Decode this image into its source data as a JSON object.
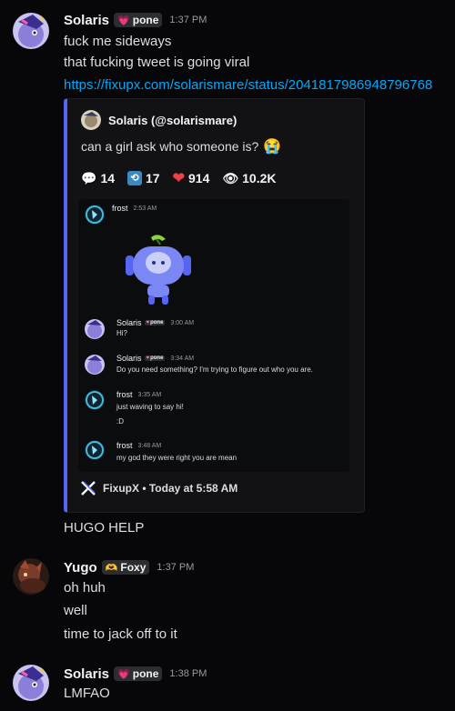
{
  "messages": [
    {
      "user": "Solaris",
      "tag": "pone",
      "time": "1:37 PM",
      "lines": [
        "fuck me sideways",
        "that fucking tweet is going viral"
      ],
      "link": "https://fixupx.com/solarismare/status/2041817986948796768"
    },
    {
      "lines_after_embed": [
        "HUGO HELP"
      ]
    },
    {
      "user": "Yugo",
      "tag": "Foxy",
      "time": "1:37 PM",
      "lines": [
        "oh huh",
        "well",
        "time to jack off to it"
      ]
    },
    {
      "user": "Solaris",
      "tag": "pone",
      "time": "1:38 PM",
      "lines": [
        "LMFAO"
      ]
    }
  ],
  "embed": {
    "author": "Solaris (@solarismare)",
    "description": "can a girl ask who someone is?",
    "description_emoji": "😭",
    "stats": {
      "replies": "14",
      "retweets": "17",
      "likes": "914",
      "views": "10.2K"
    },
    "footer": "FixupX • Today at 5:58 AM",
    "inner": [
      {
        "user": "frost",
        "time": "2:53 AM"
      },
      {
        "user": "Solaris",
        "tag": "pone",
        "time": "3:00 AM",
        "text": "Hi?"
      },
      {
        "user": "Solaris",
        "tag": "pone",
        "time": "3:34 AM",
        "text": "Do you need something? I'm trying to figure out who you are."
      },
      {
        "user": "frost",
        "time": "3:35 AM",
        "text": "just waving to say hi!",
        "text2": ":D"
      },
      {
        "user": "frost",
        "time": "3:48 AM",
        "text": "my god they were right you are mean"
      }
    ]
  },
  "colors": {
    "background": "#070709",
    "link": "#00a8fc",
    "embed_border": "#5865f2",
    "like": "#f23f43"
  }
}
